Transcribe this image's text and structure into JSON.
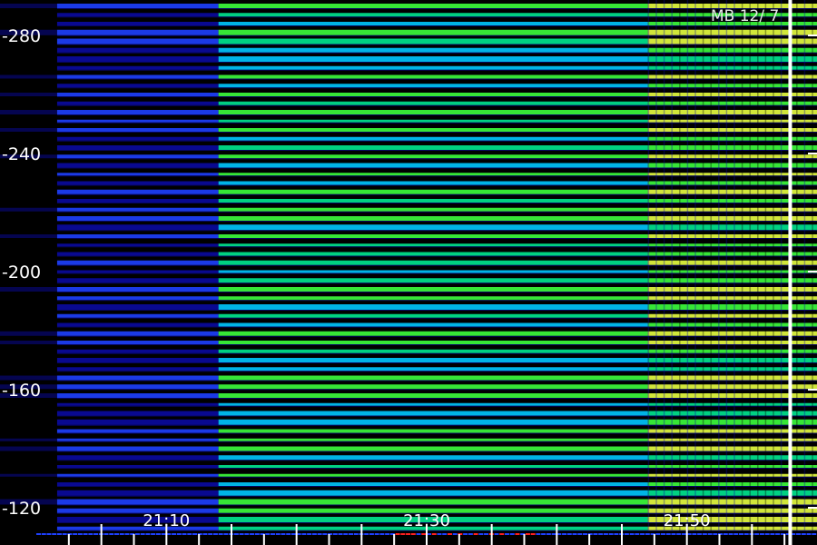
{
  "header": {
    "label": "MB 12/ 7"
  },
  "chart_data": {
    "type": "heatmap",
    "title": "",
    "xlabel": "",
    "ylabel": "",
    "header_label": "MB 12/ 7",
    "x_axis": {
      "unit": "time",
      "range_minutes": [
        21.0,
        22.0
      ],
      "tick_labels": [
        {
          "label": "21:10",
          "minute": 10
        },
        {
          "label": "21:30",
          "minute": 30
        },
        {
          "label": "21:50",
          "minute": 50
        }
      ],
      "minor_tick_every_minutes": 2.5
    },
    "y_axis": {
      "range": [
        112,
        292
      ],
      "tick_labels": [
        "-120",
        "-160",
        "-200",
        "-240",
        "-280"
      ],
      "tick_values": [
        120,
        160,
        200,
        240,
        280
      ]
    },
    "grid": false,
    "colormap": [
      "#000000",
      "#0a0aa0",
      "#1e40ff",
      "#00c8ff",
      "#00e890",
      "#3cff3c",
      "#e8ff40",
      "#ff2020"
    ],
    "colormap_level_meaning": "intensity (low to high)",
    "marker_time_minute": 57.8,
    "marker_color": "#ffffff",
    "band_tick_marks_right": [
      120,
      160,
      200,
      240,
      280
    ],
    "band_description_values": {
      "activity_onset_minute": 14,
      "strong_activity_onset_minute": 47,
      "band_spacing_units": 3
    }
  }
}
